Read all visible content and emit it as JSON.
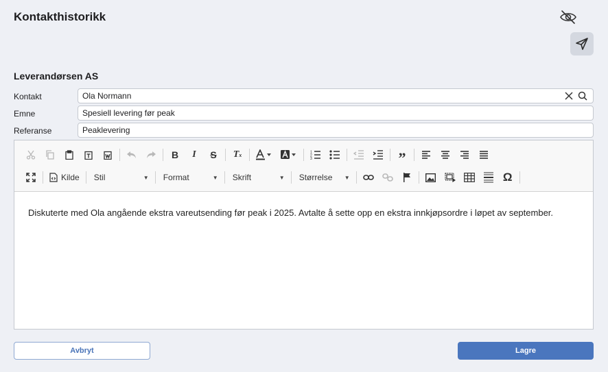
{
  "header": {
    "title": "Kontakthistorikk"
  },
  "company": "Leverandørsen AS",
  "form": {
    "contact": {
      "label": "Kontakt",
      "value": "Ola Normann"
    },
    "subject": {
      "label": "Emne",
      "value": "Spesiell levering før peak"
    },
    "reference": {
      "label": "Referanse",
      "value": "Peaklevering"
    }
  },
  "editor": {
    "toolbar": {
      "source_label": "Kilde",
      "style_label": "Stil",
      "format_label": "Format",
      "font_label": "Skrift",
      "size_label": "Størrelse"
    },
    "content": "Diskuterte med Ola angående ekstra vareutsending før peak i 2025. Avtalte å sette opp en ekstra innkjøpsordre i løpet av september."
  },
  "actions": {
    "cancel_label": "Avbryt",
    "save_label": "Lagre"
  },
  "colors": {
    "background": "#eef0f5",
    "primary": "#4a76be",
    "secondary_border": "#8ea8d2"
  },
  "icons": [
    "eye-off-icon",
    "send-icon",
    "clear-icon",
    "search-icon"
  ]
}
